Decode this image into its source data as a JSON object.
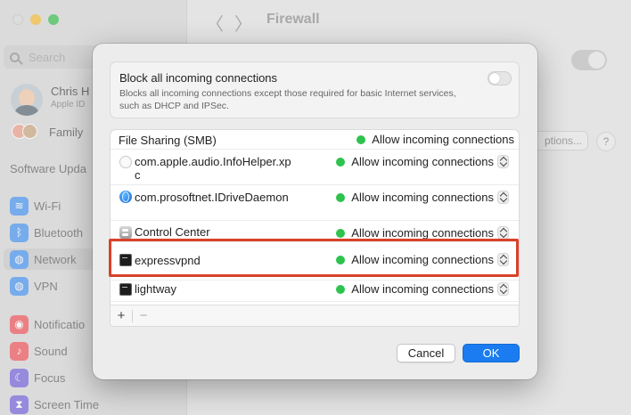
{
  "window": {
    "title": "Firewall",
    "nav_back": "〈",
    "nav_forward": "〉"
  },
  "sidebar": {
    "search_placeholder": "Search",
    "user_name": "Chris H",
    "user_sub": "Apple ID",
    "family_label": "Family",
    "software_update_label": "Software Upda",
    "items": [
      {
        "label": "Wi-Fi",
        "icon": "wifi-icon",
        "color": "#3d8ef0",
        "glyph": "≋"
      },
      {
        "label": "Bluetooth",
        "icon": "bluetooth-icon",
        "color": "#3d8ef0",
        "glyph": "ᛒ"
      },
      {
        "label": "Network",
        "icon": "network-icon",
        "color": "#3d8ef0",
        "glyph": "◍"
      },
      {
        "label": "VPN",
        "icon": "vpn-icon",
        "color": "#3d8ef0",
        "glyph": "◍"
      },
      {
        "label": "Notificatio",
        "icon": "notifications-icon",
        "color": "#ef4a50",
        "glyph": "◉"
      },
      {
        "label": "Sound",
        "icon": "sound-icon",
        "color": "#ef4a50",
        "glyph": "♪"
      },
      {
        "label": "Focus",
        "icon": "focus-icon",
        "color": "#6a5ad8",
        "glyph": "☾"
      },
      {
        "label": "Screen Time",
        "icon": "screen-time-icon",
        "color": "#6a5ad8",
        "glyph": "⧗"
      }
    ],
    "active_item": "Network"
  },
  "background_main": {
    "options_button": "ptions...",
    "help_button": "?"
  },
  "dialog": {
    "block_all": {
      "title": "Block all incoming connections",
      "description": "Blocks all incoming connections except those required for basic Internet services, such as DHCP and IPSec.",
      "enabled": false
    },
    "apps": [
      {
        "name": "File Sharing (SMB)",
        "status": "Allow incoming connections",
        "icon": "none",
        "has_stepper": false
      },
      {
        "name": "com.apple.audio.InfoHelper.xpc",
        "status": "Allow incoming connections",
        "icon": "generic-app-icon",
        "has_stepper": true
      },
      {
        "name": "com.prosoftnet.IDriveDaemon",
        "status": "Allow incoming connections",
        "icon": "globe-icon",
        "has_stepper": true
      },
      {
        "name": "Control Center",
        "status": "Allow incoming connections",
        "icon": "control-center-icon",
        "has_stepper": true
      },
      {
        "name": "expressvpnd",
        "status": "Allow incoming connections",
        "icon": "terminal-icon",
        "has_stepper": true,
        "highlighted": true
      },
      {
        "name": "lightway",
        "status": "Allow incoming connections",
        "icon": "terminal-icon",
        "has_stepper": true
      }
    ],
    "add_button": "+",
    "remove_button": "−",
    "cancel_button": "Cancel",
    "ok_button": "OK",
    "status_color": "#2dc34d",
    "highlight_color": "#d9412a",
    "accent_color": "#1a7cf0"
  }
}
